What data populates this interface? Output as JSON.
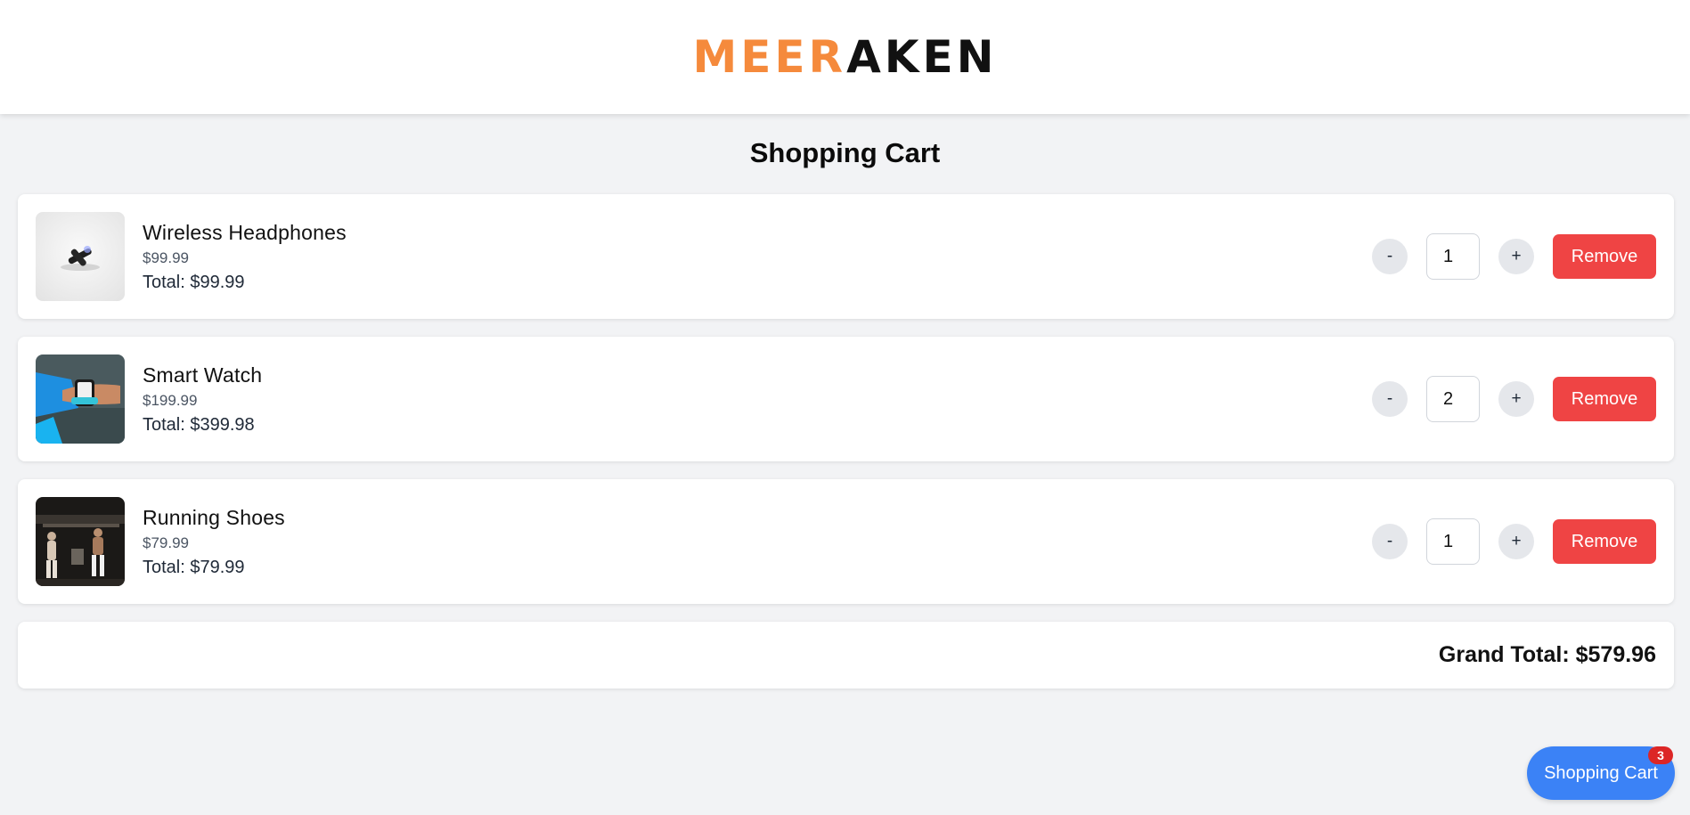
{
  "brand": {
    "logo_part1": "MEER",
    "logo_part2": "AKEN",
    "orange": "#f58a3c",
    "black": "#111111"
  },
  "page": {
    "title": "Shopping Cart"
  },
  "cart": {
    "items": [
      {
        "name": "Wireless Headphones",
        "price": "$99.99",
        "total": "Total: $99.99",
        "quantity": "1",
        "image_icon": "headphones-product-image"
      },
      {
        "name": "Smart Watch",
        "price": "$199.99",
        "total": "Total: $399.98",
        "quantity": "2",
        "image_icon": "smart-watch-product-image"
      },
      {
        "name": "Running Shoes",
        "price": "$79.99",
        "total": "Total: $79.99",
        "quantity": "1",
        "image_icon": "running-shoes-product-image"
      }
    ],
    "decrement_label": "-",
    "increment_label": "+",
    "remove_label": "Remove",
    "grand_total": "Grand Total: $579.96"
  },
  "fab": {
    "label": "Shopping Cart",
    "badge_count": "3"
  },
  "colors": {
    "remove": "#ef4444",
    "fab": "#3b82f6",
    "badge": "#dc2626",
    "background": "#f2f3f5"
  }
}
